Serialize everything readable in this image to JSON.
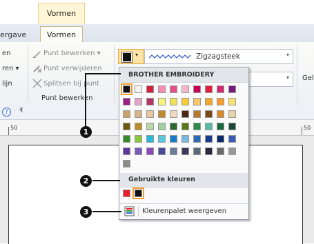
{
  "ribbon": {
    "context_tab": "Vormen",
    "tabs": [
      {
        "label": "ergave"
      },
      {
        "label": "Vormen"
      }
    ],
    "left_group_partial": {
      "item1": "en",
      "item2": "ren ▾",
      "item3": "lijn"
    },
    "edit_group": {
      "item_edit_point": "Punt bewerken ▾",
      "item_delete_point": "Punt verwijderen",
      "item_split": "Splitsen bij punt",
      "group_label": "Punt bewerken"
    },
    "stitch_type": "Zigzagsteek",
    "right_partial": "Gel"
  },
  "toolbar2": {
    "help_glyph": "?",
    "extra_glyph": "₹"
  },
  "ruler": {
    "left_mark": "50",
    "right_mark": "50"
  },
  "color_panel": {
    "header_brother": "BROTHER EMBROIDERY",
    "header_used": "Gebruikte kleuren",
    "open_palette": "Kleurenpalet weergeven",
    "brother_colors": [
      [
        "#111111",
        "#f2f2f2",
        "#d81e3a",
        "#f78cb5",
        "#e34f88",
        "#f5b6c8",
        "#c8005a",
        "#e0203e",
        "#d12a6e",
        "#7a1a7e"
      ],
      [
        "#9a1f86",
        "#e5a4c8",
        "#b8326a",
        "#f6f27a",
        "#f1e05a",
        "#f6cc3a",
        "#f7c76c",
        "#f2a82c",
        "#f59c2c",
        "#f8e06c"
      ],
      [
        "#c9a46a",
        "#d7b58a",
        "#e8c7a0",
        "#c08a2c",
        "#f3d9c0",
        "#4a2a14",
        "#b97a2c",
        "#7a4a1a",
        "#d68a2c",
        "#e6d4a8"
      ],
      [
        "#6a5a10",
        "#b88c2c",
        "#b9d8a8",
        "#9fd2a0",
        "#2a6a2a",
        "#5a7a1a",
        "#2a8a4a",
        "#5ab8a8",
        "#1a6a3a",
        "#1a4a3a"
      ],
      [
        "#3a8a2a",
        "#8ac83a",
        "#2ab8d8",
        "#58c8e0",
        "#1a7ac8",
        "#7ab8e0",
        "#2a6ab8",
        "#1a3a8a",
        "#0a2a6a",
        "#3a5ab8"
      ],
      [
        "#5a3a9a",
        "#7a5ab8",
        "#8a4ab8",
        "#4a4a9a",
        "#6a7a9a",
        "#3a3a5a",
        "#5a6a7a",
        "#2a2a3a",
        "#6a6a6a",
        "#9a9a9a"
      ],
      [
        "#8a8a8a"
      ]
    ],
    "selected_brother_index": [
      0,
      0
    ],
    "used_colors": [
      "#e8202a",
      "#111111"
    ],
    "selected_used_index": 1
  },
  "callouts": [
    "1",
    "2",
    "3"
  ],
  "colors": {
    "accent_orange": "#f0a030",
    "ribbon_border": "#b9c6d8"
  }
}
